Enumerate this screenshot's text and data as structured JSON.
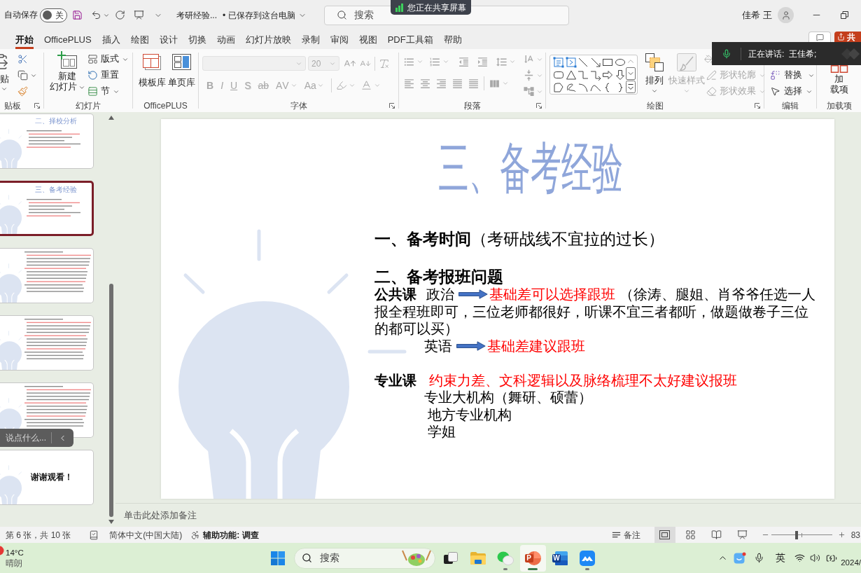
{
  "title_bar": {
    "autosave": {
      "label": "自动保存",
      "on": false,
      "state_label": "关"
    },
    "file_name": "考研经验...",
    "save_status": "• 已保存到这台电脑",
    "search": {
      "placeholder": "搜索"
    },
    "user_name": "佳希 王"
  },
  "share_banner": {
    "text": "您正在共享屏幕"
  },
  "tabs": [
    {
      "label": "开始",
      "selected": true
    },
    {
      "label": "OfficePLUS",
      "selected": false
    },
    {
      "label": "插入",
      "selected": false
    },
    {
      "label": "绘图",
      "selected": false
    },
    {
      "label": "设计",
      "selected": false
    },
    {
      "label": "切换",
      "selected": false
    },
    {
      "label": "动画",
      "selected": false
    },
    {
      "label": "幻灯片放映",
      "selected": false
    },
    {
      "label": "录制",
      "selected": false
    },
    {
      "label": "审阅",
      "selected": false
    },
    {
      "label": "视图",
      "selected": false
    },
    {
      "label": "PDF工具箱",
      "selected": false
    },
    {
      "label": "帮助",
      "selected": false
    }
  ],
  "share_button": {
    "label": "共"
  },
  "speaking_banner": {
    "text": "正在讲话:  王佳希;"
  },
  "ribbon": {
    "clipboard": {
      "title": "贴板",
      "paste": "贴"
    },
    "slides": {
      "title": "幻灯片",
      "new_slide": [
        "新建",
        "幻灯片"
      ],
      "layout": "版式",
      "reset": "重置",
      "section": "节"
    },
    "officeplus": {
      "title": "OfficePLUS",
      "buttons": [
        {
          "kind": "template",
          "label": "模板库"
        },
        {
          "kind": "page",
          "label": "单页库"
        }
      ]
    },
    "font": {
      "title": "字体",
      "disabled": true,
      "size": "20",
      "format_buttons": [
        {
          "kind": "bold",
          "label": "B"
        },
        {
          "kind": "italic",
          "label": "I"
        },
        {
          "kind": "underline",
          "label": "U"
        },
        {
          "kind": "shadow",
          "label": "S"
        },
        {
          "kind": "strikethrough",
          "label": "ab"
        },
        {
          "kind": "spacing",
          "label": "AV"
        },
        {
          "kind": "case",
          "label": "Aa"
        }
      ]
    },
    "paragraph": {
      "title": "段落",
      "disabled": true
    },
    "drawing": {
      "title": "绘图",
      "arrange": "排列",
      "quick_styles": {
        "label": "快速样式",
        "disabled": true
      },
      "shape_outline": {
        "label": "形状轮廓",
        "disabled": true
      },
      "shape_effects": {
        "label": "形状效果",
        "disabled": true
      }
    },
    "editing": {
      "title": "编辑",
      "replace": "替换",
      "select": "选择"
    },
    "addins": {
      "title": "加载项",
      "button": [
        "加",
        "载项"
      ]
    }
  },
  "thumbnails": [
    {
      "kind": "content",
      "title": "二、择校分析",
      "selected": false
    },
    {
      "kind": "content",
      "title": "三、备考经验",
      "selected": true
    },
    {
      "kind": "dense",
      "selected": false
    },
    {
      "kind": "dense",
      "selected": false
    },
    {
      "kind": "dense",
      "selected": false
    },
    {
      "kind": "closing",
      "title": "谢谢观看！",
      "selected": false
    }
  ],
  "chat_box": {
    "placeholder": "说点什么..."
  },
  "slide": {
    "title": "三、备考经验",
    "time_heading": "**一、备考时间**（考研战线不宜拉的过长）",
    "class_heading": "二、备考报班问题",
    "courses": [
      {
        "label": "公共课",
        "items": [
          {
            "subject": "政治",
            "advice": "基础差可以选择跟班",
            "note_lines": [
              "（徐涛、腿姐、肖爷爷任选一人",
              "报全程班即可，三位老师都很好，听课不宜三者都听，做题做卷子三位",
              "的都可以买）"
            ]
          },
          {
            "subject": "英语",
            "advice": "基础差建议跟班"
          }
        ]
      },
      {
        "label": "专业课",
        "advice": "约束力差、文科逻辑以及脉络梳理不太好建议报班",
        "options": [
          "专业大机构（舞研、硕蕾）",
          "地方专业机构",
          "学姐"
        ]
      }
    ]
  },
  "notes": {
    "placeholder": "单击此处添加备注"
  },
  "status_bar": {
    "slide_counter": "第 6 张，共 10 张",
    "language": "简体中文(中国大陆)",
    "accessibility": "辅助功能: 调查",
    "notes_button": "备注",
    "views": [
      {
        "kind": "normal",
        "selected": true
      },
      {
        "kind": "sorter",
        "selected": false
      },
      {
        "kind": "reading",
        "selected": false
      },
      {
        "kind": "slideshow",
        "selected": false
      }
    ],
    "zoom": {
      "level": 0.42,
      "value": "83"
    }
  },
  "taskbar": {
    "weather": {
      "temperature": "14°C",
      "condition": "晴朗"
    },
    "search": {
      "placeholder": "搜索"
    },
    "apps": [
      {
        "kind": "task_view",
        "running": false,
        "active": false
      },
      {
        "kind": "explorer",
        "running": false,
        "active": false
      },
      {
        "kind": "wechat",
        "running": true,
        "active": false
      },
      {
        "kind": "powerpoint",
        "running": true,
        "active": true,
        "logo_text": "P"
      },
      {
        "kind": "word",
        "running": false,
        "active": false,
        "logo_text": "W"
      },
      {
        "kind": "meeting",
        "running": true,
        "active": false
      }
    ],
    "tray": {
      "input_method": "英",
      "date": "2024/"
    }
  }
}
